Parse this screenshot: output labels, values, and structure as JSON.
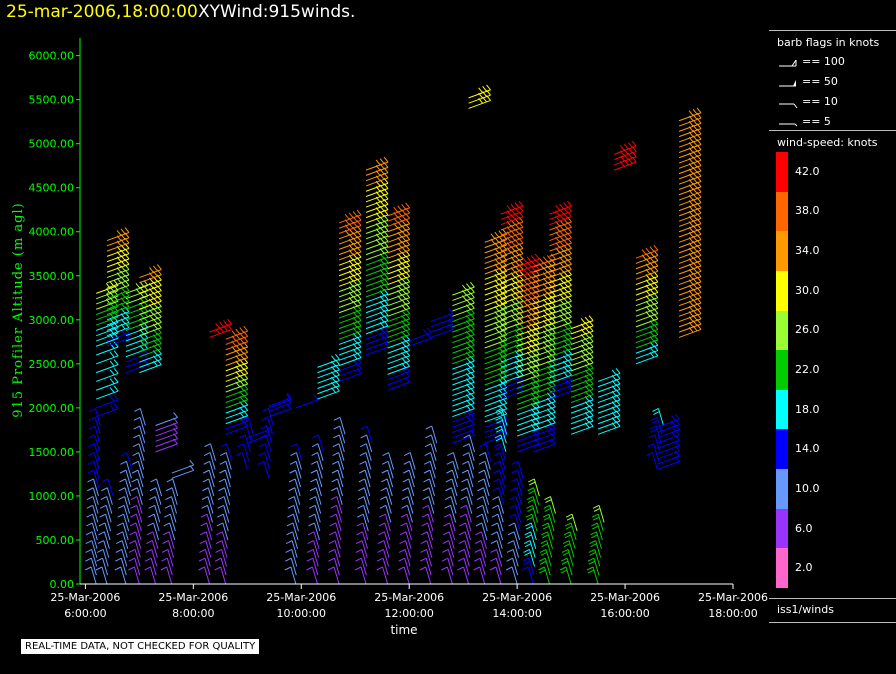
{
  "header": {
    "datetime": "25-mar-2006,18:00:00",
    "product": "XYWind:915winds."
  },
  "legend": {
    "flags_title": "barb flags in knots",
    "flags": [
      {
        "label": "== 100"
      },
      {
        "label": "== 50"
      },
      {
        "label": "== 10"
      },
      {
        "label": "== 5"
      }
    ],
    "speed_title": "wind-speed: knots",
    "speed_bins": [
      {
        "label": "42.0",
        "color": "#ff0000"
      },
      {
        "label": "38.0",
        "color": "#ff6600"
      },
      {
        "label": "34.0",
        "color": "#ff9900"
      },
      {
        "label": "30.0",
        "color": "#ffff00"
      },
      {
        "label": "26.0",
        "color": "#99ff33"
      },
      {
        "label": "22.0",
        "color": "#00cc00"
      },
      {
        "label": "18.0",
        "color": "#00ffff"
      },
      {
        "label": "14.0",
        "color": "#0000ff"
      },
      {
        "label": "10.0",
        "color": "#6699ff"
      },
      {
        "label": "6.0",
        "color": "#9933ff"
      },
      {
        "label": "2.0",
        "color": "#ff66cc"
      }
    ],
    "source": "iss1/winds"
  },
  "disclaimer": "REAL-TIME DATA, NOT CHECKED FOR QUALITY",
  "chart_data": {
    "type": "scatter",
    "title": "",
    "xlabel": "time",
    "ylabel": "915 Profiler Altitude (m agl)",
    "ylim": [
      0,
      6200
    ],
    "xlim": [
      5.9,
      18.0
    ],
    "yticks": [
      "0.00",
      "500.00",
      "1000.00",
      "1500.00",
      "2000.00",
      "2500.00",
      "3000.00",
      "3500.00",
      "4000.00",
      "4500.00",
      "5000.00",
      "5500.00",
      "6000.00"
    ],
    "xticks": [
      {
        "t": 6,
        "date": "25-Mar-2006",
        "time": "6:00:00"
      },
      {
        "t": 8,
        "date": "25-Mar-2006",
        "time": "8:00:00"
      },
      {
        "t": 10,
        "date": "25-Mar-2006",
        "time": "10:00:00"
      },
      {
        "t": 12,
        "date": "25-Mar-2006",
        "time": "12:00:00"
      },
      {
        "t": 14,
        "date": "25-Mar-2006",
        "time": "14:00:00"
      },
      {
        "t": 16,
        "date": "25-Mar-2006",
        "time": "16:00:00"
      },
      {
        "t": 18,
        "date": "25-Mar-2006",
        "time": "18:00:00"
      }
    ],
    "grid": false,
    "series": [
      {
        "t": 6.2,
        "low": [
          0,
          2600,
          8,
          18
        ],
        "high": [
          2700,
          3350,
          16,
          30
        ]
      },
      {
        "t": 6.4,
        "low": [
          0,
          1000,
          8,
          12
        ],
        "high": [
          2700,
          3900,
          14,
          34
        ]
      },
      {
        "t": 6.75,
        "low": [
          0,
          1300,
          8,
          12
        ],
        "high": [
          2400,
          3300,
          14,
          26
        ]
      },
      {
        "t": 7.0,
        "low": [
          0,
          1800,
          6,
          10
        ],
        "high": [
          2400,
          3500,
          18,
          34
        ]
      },
      {
        "t": 7.3,
        "low": [
          0,
          1000,
          6,
          10
        ],
        "high": [
          1500,
          1800,
          6,
          8
        ]
      },
      {
        "t": 7.6,
        "low": [
          0,
          1000,
          6,
          10
        ],
        "high": [
          1200,
          1300,
          8,
          10
        ]
      },
      {
        "t": 8.3,
        "low": [
          0,
          1400,
          6,
          10
        ],
        "high": [
          2800,
          2900,
          40,
          42
        ]
      },
      {
        "t": 8.6,
        "low": [
          0,
          1400,
          6,
          12
        ],
        "high": [
          1700,
          2800,
          14,
          40
        ]
      },
      {
        "t": 9.0,
        "low": [
          1300,
          1700,
          12,
          14
        ],
        "high": [
          1600,
          1700,
          12,
          14
        ]
      },
      {
        "t": 9.4,
        "low": [
          1200,
          2000,
          12,
          14
        ],
        "high": [
          1900,
          2050,
          12,
          14
        ]
      },
      {
        "t": 9.9,
        "low": [
          0,
          1400,
          8,
          12
        ],
        "high": [
          2000,
          2050,
          14,
          14
        ]
      },
      {
        "t": 10.3,
        "low": [
          0,
          1500,
          6,
          12
        ],
        "high": [
          2100,
          2500,
          16,
          18
        ]
      },
      {
        "t": 10.7,
        "low": [
          0,
          1700,
          6,
          10
        ],
        "high": [
          2300,
          4100,
          14,
          38
        ]
      },
      {
        "t": 11.2,
        "low": [
          0,
          1600,
          6,
          12
        ],
        "high": [
          2600,
          4700,
          14,
          34
        ]
      },
      {
        "t": 11.6,
        "low": [
          0,
          1300,
          6,
          10
        ],
        "high": [
          2200,
          4200,
          14,
          38
        ]
      },
      {
        "t": 12.0,
        "low": [
          0,
          1300,
          6,
          10
        ],
        "high": [
          2700,
          2800,
          14,
          16
        ]
      },
      {
        "t": 12.4,
        "low": [
          0,
          1600,
          6,
          10
        ],
        "high": [
          2800,
          3000,
          14,
          14
        ]
      },
      {
        "t": 12.8,
        "low": [
          0,
          1300,
          6,
          10
        ],
        "high": [
          1600,
          3300,
          14,
          26
        ]
      },
      {
        "t": 13.1,
        "low": [
          0,
          1500,
          6,
          10
        ],
        "high": [
          5400,
          5550,
          28,
          30
        ]
      },
      {
        "t": 13.4,
        "low": [
          0,
          1400,
          6,
          12
        ],
        "high": [
          1600,
          3900,
          14,
          36
        ]
      },
      {
        "t": 13.7,
        "low": [
          0,
          1800,
          6,
          18
        ],
        "high": [
          2100,
          4200,
          14,
          42
        ]
      },
      {
        "t": 14.0,
        "low": [
          0,
          1200,
          10,
          14
        ],
        "high": [
          1500,
          3600,
          14,
          42
        ]
      },
      {
        "t": 14.3,
        "low": [
          0,
          1000,
          14,
          24
        ],
        "high": [
          1500,
          3600,
          14,
          36
        ]
      },
      {
        "t": 14.6,
        "low": [
          0,
          800,
          20,
          24
        ],
        "high": [
          2100,
          4200,
          14,
          42
        ]
      },
      {
        "t": 15.0,
        "low": [
          0,
          600,
          20,
          24
        ],
        "high": [
          1700,
          2900,
          16,
          30
        ]
      },
      {
        "t": 15.5,
        "low": [
          0,
          700,
          20,
          24
        ],
        "high": [
          1700,
          2350,
          16,
          20
        ]
      },
      {
        "t": 15.8,
        "low": [
          0,
          0,
          20,
          20
        ],
        "high": [
          4700,
          4900,
          42,
          42
        ]
      },
      {
        "t": 16.2,
        "low": [
          0,
          0,
          20,
          20
        ],
        "high": [
          2500,
          3700,
          18,
          36
        ]
      },
      {
        "t": 16.6,
        "low": [
          1300,
          1800,
          14,
          16
        ],
        "high": [
          1300,
          1800,
          14,
          16
        ]
      },
      {
        "t": 17.0,
        "low": [
          0,
          0,
          20,
          20
        ],
        "high": [
          2800,
          5300,
          34,
          32
        ]
      }
    ]
  }
}
